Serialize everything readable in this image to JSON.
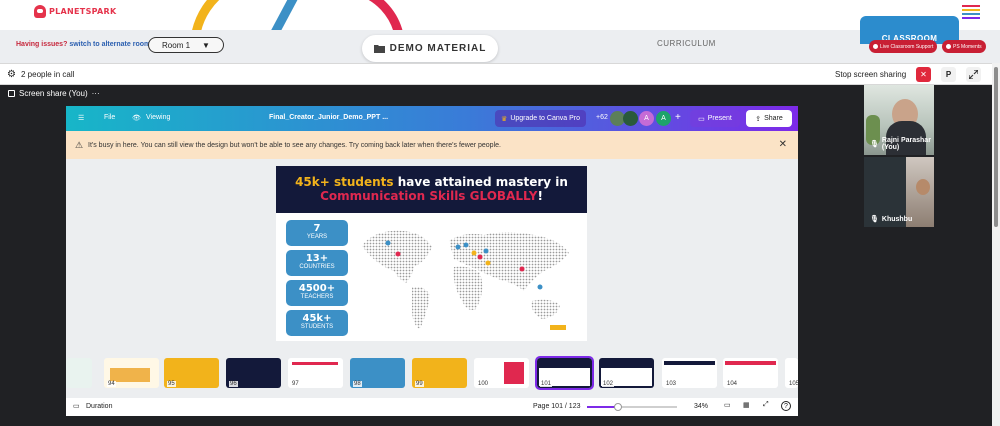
{
  "brand": {
    "logo_text": "PLANETSPARK"
  },
  "header": {
    "issues_prefix": "Having issues?",
    "issues_link": "switch to alternate room",
    "room": "Room 1",
    "demo_material": "DEMO MATERIAL",
    "curriculum": "CURRICULUM",
    "classroom": "CLASSROOM",
    "live_support": "Live Classroom Support",
    "ps_moments": "PS Moments"
  },
  "callbar": {
    "people_in_call": "2 people in call",
    "stop_sharing": "Stop screen sharing",
    "p_button": "P"
  },
  "stage": {
    "share_label": "Screen share (You)",
    "more": "···"
  },
  "canva": {
    "file": "File",
    "viewing": "Viewing",
    "doc_title": "Final_Creator_Junior_Demo_PPT ...",
    "upgrade": "Upgrade to Canva Pro",
    "plus_count": "+62",
    "avatars": [
      "A",
      "A"
    ],
    "plus": "+",
    "present": "Present",
    "share": "Share",
    "warning": "It's busy in here. You can still view the design but won't be able to see any changes. Try coming back later when there's fewer people.",
    "slide": {
      "line1_highlight": "45k+ students",
      "line1_rest": " have attained mastery in",
      "line2_highlight": "Communication Skills GLOBALLY",
      "line2_rest": "!",
      "stats": [
        {
          "value": "7",
          "label": "YEARS"
        },
        {
          "value": "13+",
          "label": "COUNTRIES"
        },
        {
          "value": "4500+",
          "label": "TEACHERS"
        },
        {
          "value": "45k+",
          "label": "STUDENTS"
        }
      ]
    },
    "thumbnails": [
      {
        "num": ""
      },
      {
        "num": "94"
      },
      {
        "num": "95"
      },
      {
        "num": "96"
      },
      {
        "num": "97"
      },
      {
        "num": "98"
      },
      {
        "num": "99"
      },
      {
        "num": "100"
      },
      {
        "num": "101"
      },
      {
        "num": "102"
      },
      {
        "num": "103"
      },
      {
        "num": "104"
      },
      {
        "num": "105"
      }
    ],
    "duration": "Duration",
    "page": "Page 101 / 123",
    "zoom_percent": "34%",
    "zoom_level": 0.34
  },
  "participants": [
    {
      "name": "Rajni Parashar (You)"
    },
    {
      "name": "Khushbu"
    }
  ],
  "icons": {
    "colors": {
      "brand_red": "#e5334b",
      "canva_purple": "#7d2ae8",
      "classroom_blue": "#2c8ccd",
      "stop_red": "#e0283c"
    }
  }
}
